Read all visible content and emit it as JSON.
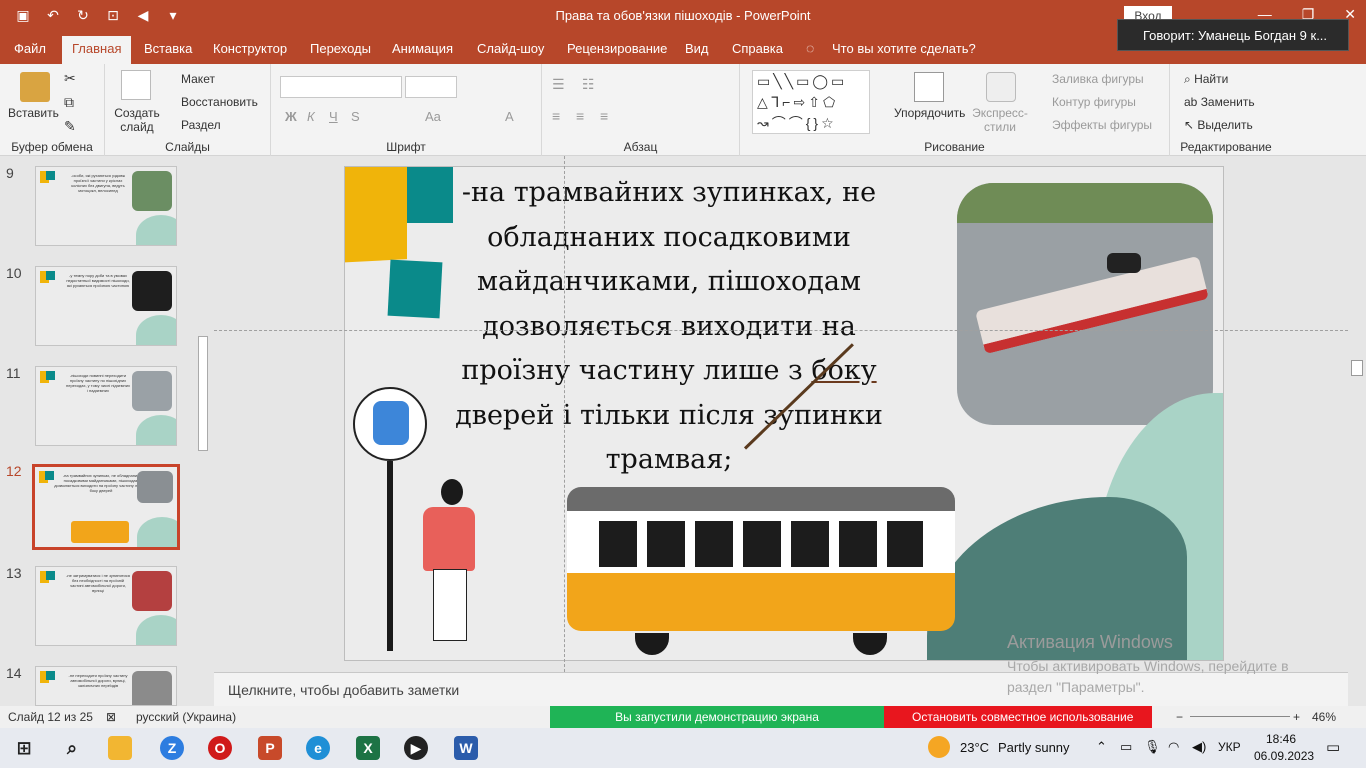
{
  "titlebar": {
    "title": "Права та обов'язки пішоходів  -  PowerPoint",
    "login": "Вход",
    "qat_icons": [
      "save-icon",
      "undo-icon",
      "redo-icon",
      "slideshow-icon",
      "volume-icon",
      "customize-icon"
    ]
  },
  "tabs": [
    {
      "label": "Файл"
    },
    {
      "label": "Главная"
    },
    {
      "label": "Вставка"
    },
    {
      "label": "Конструктор"
    },
    {
      "label": "Переходы"
    },
    {
      "label": "Анимация"
    },
    {
      "label": "Слайд-шоу"
    },
    {
      "label": "Рецензирование"
    },
    {
      "label": "Вид"
    },
    {
      "label": "Справка"
    }
  ],
  "tellme": "Что вы хотите сделать?",
  "speaker_toast": "Говорит: Уманець Богдан 9 к...",
  "ribbon": {
    "clipboard": {
      "paste": "Вставить",
      "label": "Буфер обмена"
    },
    "slides": {
      "new_slide": "Создать слайд",
      "layout": "Макет",
      "reset": "Восстановить",
      "section": "Раздел",
      "label": "Слайды"
    },
    "font": {
      "label": "Шрифт",
      "bold": "Ж",
      "italic": "К",
      "underline": "Ч",
      "strike": "S",
      "aa": "Aa",
      "a": "A"
    },
    "paragraph": {
      "label": "Абзац"
    },
    "drawing": {
      "arrange": "Упорядочить",
      "quick_styles": "Экспресс-стили",
      "fill": "Заливка фигуры",
      "outline": "Контур фигуры",
      "effects": "Эффекты фигуры",
      "label": "Рисование"
    },
    "editing": {
      "find": "Найти",
      "replace": "Заменить",
      "select": "Выделить",
      "label": "Редактирование"
    }
  },
  "thumbnails": [
    {
      "num": "9",
      "text": "-особи, які рухаються уздовж проїзної частини у кріслах колісних без двигуна, ведуть мотоцикл, велосипед"
    },
    {
      "num": "10",
      "text": "-у темну пору доби та в умовах недостатньої видимості пішоходи, які рухаються проїзною частиною"
    },
    {
      "num": "11",
      "text": "-пішоходи повинні переходити проїзну частину по пішохідних переходах, у тому числі підземних і надземних"
    },
    {
      "num": "12",
      "text": "-на трамвайних зупинках, не обладнаних посадковими майданчиками, пішоходам дозволяється виходити на проїзну частину лише з боку дверей"
    },
    {
      "num": "13",
      "text": "-не затримуватися і не зупинятися без необхідності на проїзній частині автомобільної дороги, вулиці"
    },
    {
      "num": "14",
      "text": "-не переходити проїзну частину автомобільної дороги, вулиці, залізничних переїздів"
    }
  ],
  "slide": {
    "text_lines": [
      "-на трамвайних зупинках, не",
      "обладнаних посадковими",
      "майданчиками, пішоходам",
      "дозволяється виходити на",
      "проїзну частину лише з",
      "боку",
      "дверей і тільки після зупинки",
      "трамвая;"
    ],
    "colors": {
      "yellow": "#f0b40a",
      "teal": "#0a8a8a",
      "green_blob": "#a9d3c6",
      "dark_blob": "#4e7e77",
      "tram_yellow": "#f2a51a"
    }
  },
  "notes_placeholder": "Щелкните, чтобы добавить заметки",
  "watermark": {
    "title": "Активация Windows",
    "body": "Чтобы активировать Windows, перейдите в раздел \"Параметры\"."
  },
  "statusbar": {
    "slide_count": "Слайд 12 из 25",
    "language": "русский (Украина)",
    "share_running": "Вы запустили демонстрацию экрана",
    "stop_share": "Остановить совместное использование",
    "zoom": "46%"
  },
  "taskbar": {
    "weather_temp": "23°C",
    "weather_text": "Partly sunny",
    "lang": "УКР",
    "time": "18:46",
    "date": "06.09.2023"
  }
}
